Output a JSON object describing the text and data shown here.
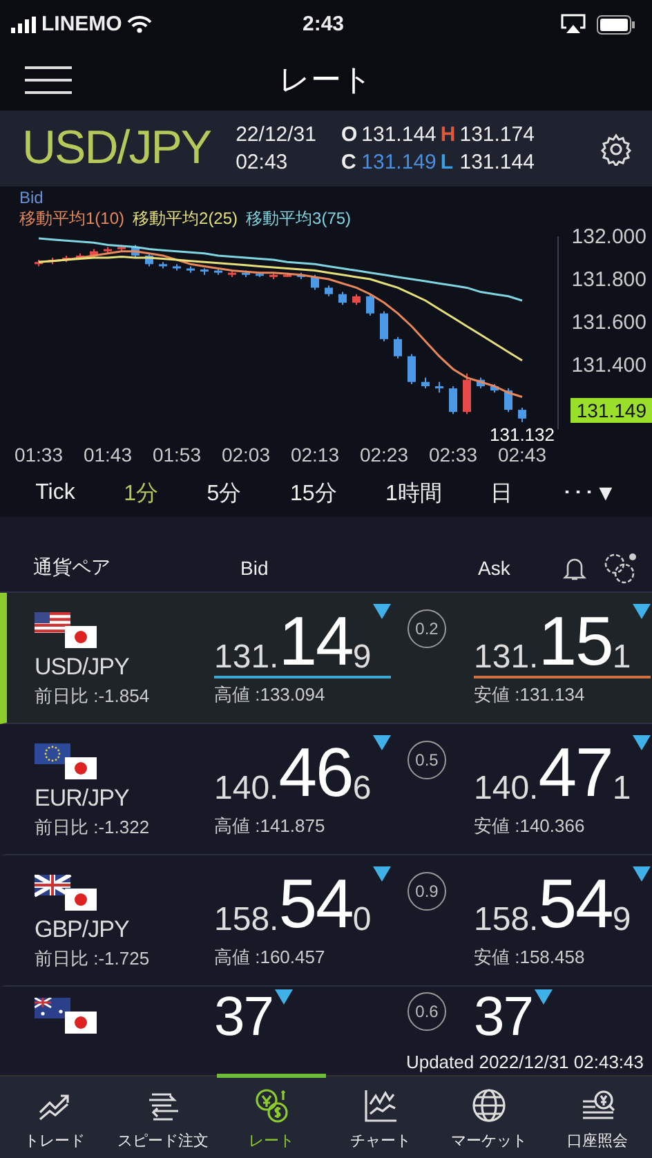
{
  "status_bar": {
    "carrier": "LINEMO",
    "time": "2:43"
  },
  "header": {
    "title": "レート"
  },
  "instrument": {
    "symbol": "USD/JPY",
    "date": "22/12/31",
    "time": "02:43",
    "open_label": "O",
    "open": "131.144",
    "high_label": "H",
    "high": "131.174",
    "close_label": "C",
    "close": "131.149",
    "low_label": "L",
    "low": "131.144"
  },
  "chart": {
    "price_type": "Bid",
    "low_marker": "131.132",
    "current_price": "131.149",
    "chart_data": {
      "type": "candlestick",
      "categories": [
        "01:33",
        null,
        null,
        null,
        null,
        "01:43",
        null,
        null,
        null,
        null,
        "01:53",
        null,
        null,
        null,
        null,
        "02:03",
        null,
        null,
        null,
        null,
        "02:13",
        null,
        null,
        null,
        null,
        "02:23",
        null,
        null,
        null,
        null,
        "02:33",
        null,
        null,
        null,
        null,
        "02:43"
      ],
      "ylim": [
        131.1,
        132.0
      ],
      "ohlc": [
        [
          131.87,
          131.89,
          131.86,
          131.88
        ],
        [
          131.88,
          131.9,
          131.87,
          131.89
        ],
        [
          131.89,
          131.91,
          131.88,
          131.9
        ],
        [
          131.9,
          131.92,
          131.89,
          131.91
        ],
        [
          131.91,
          131.94,
          131.9,
          131.93
        ],
        [
          131.93,
          131.95,
          131.92,
          131.94
        ],
        [
          131.94,
          131.96,
          131.93,
          131.95
        ],
        [
          131.95,
          131.96,
          131.9,
          131.91
        ],
        [
          131.91,
          131.92,
          131.86,
          131.87
        ],
        [
          131.87,
          131.88,
          131.85,
          131.86
        ],
        [
          131.86,
          131.87,
          131.84,
          131.85
        ],
        [
          131.85,
          131.86,
          131.83,
          131.84
        ],
        [
          131.845,
          131.85,
          131.82,
          131.84
        ],
        [
          131.84,
          131.85,
          131.82,
          131.83
        ],
        [
          131.82,
          131.84,
          131.81,
          131.83
        ],
        [
          131.83,
          131.84,
          131.81,
          131.82
        ],
        [
          131.825,
          131.83,
          131.81,
          131.82
        ],
        [
          131.81,
          131.83,
          131.8,
          131.82
        ],
        [
          131.815,
          131.83,
          131.81,
          131.82
        ],
        [
          131.82,
          131.83,
          131.8,
          131.81
        ],
        [
          131.81,
          131.82,
          131.75,
          131.76
        ],
        [
          131.76,
          131.77,
          131.72,
          131.73
        ],
        [
          131.73,
          131.74,
          131.68,
          131.69
        ],
        [
          131.69,
          131.73,
          131.68,
          131.72
        ],
        [
          131.72,
          131.73,
          131.63,
          131.64
        ],
        [
          131.64,
          131.65,
          131.51,
          131.52
        ],
        [
          131.52,
          131.53,
          131.43,
          131.44
        ],
        [
          131.44,
          131.45,
          131.31,
          131.32
        ],
        [
          131.32,
          131.34,
          131.29,
          131.3
        ],
        [
          131.3,
          131.32,
          131.27,
          131.29
        ],
        [
          131.29,
          131.3,
          131.17,
          131.18
        ],
        [
          131.18,
          131.36,
          131.17,
          131.33
        ],
        [
          131.33,
          131.34,
          131.29,
          131.3
        ],
        [
          131.3,
          131.31,
          131.27,
          131.28
        ],
        [
          131.28,
          131.29,
          131.18,
          131.19
        ],
        [
          131.19,
          131.2,
          131.132,
          131.149
        ]
      ],
      "series": [
        {
          "type": "line",
          "name": "移動平均1(10)",
          "color": "#e8875a",
          "values": [
            131.88,
            131.885,
            131.89,
            131.9,
            131.91,
            131.92,
            131.93,
            131.93,
            131.92,
            131.91,
            131.89,
            131.87,
            131.86,
            131.85,
            131.84,
            131.835,
            131.83,
            131.83,
            131.825,
            131.82,
            131.81,
            131.8,
            131.78,
            131.76,
            131.73,
            131.69,
            131.64,
            131.58,
            131.51,
            131.44,
            131.38,
            131.34,
            131.32,
            131.3,
            131.27,
            131.25
          ]
        },
        {
          "type": "line",
          "name": "移動平均2(25)",
          "color": "#e6e07a",
          "values": [
            131.88,
            131.885,
            131.89,
            131.895,
            131.9,
            131.9,
            131.905,
            131.9,
            131.9,
            131.895,
            131.89,
            131.885,
            131.88,
            131.875,
            131.87,
            131.865,
            131.86,
            131.855,
            131.85,
            131.845,
            131.84,
            131.83,
            131.82,
            131.81,
            131.8,
            131.78,
            131.76,
            131.73,
            131.7,
            131.66,
            131.62,
            131.58,
            131.54,
            131.5,
            131.46,
            131.42
          ]
        },
        {
          "type": "line",
          "name": "移動平均3(75)",
          "color": "#7fd6e0",
          "values": [
            131.99,
            131.985,
            131.98,
            131.975,
            131.97,
            131.96,
            131.955,
            131.95,
            131.94,
            131.935,
            131.93,
            131.925,
            131.92,
            131.91,
            131.905,
            131.9,
            131.895,
            131.89,
            131.88,
            131.875,
            131.87,
            131.86,
            131.85,
            131.84,
            131.83,
            131.82,
            131.81,
            131.8,
            131.79,
            131.78,
            131.77,
            131.76,
            131.74,
            131.73,
            131.72,
            131.7
          ]
        }
      ],
      "yticks": [
        {
          "value": 131.4,
          "label": "131.400"
        },
        {
          "value": 131.6,
          "label": "131.600"
        },
        {
          "value": 131.8,
          "label": "131.800"
        },
        {
          "value": 132.0,
          "label": "132.000"
        }
      ]
    }
  },
  "periods": [
    {
      "label": "Tick",
      "selected": false
    },
    {
      "label": "1分",
      "selected": true
    },
    {
      "label": "5分",
      "selected": false
    },
    {
      "label": "15分",
      "selected": false
    },
    {
      "label": "1時間",
      "selected": false
    },
    {
      "label": "日",
      "selected": false
    },
    {
      "label": "･･･▼",
      "selected": false
    }
  ],
  "columns": {
    "pair": "通貨ペア",
    "bid": "Bid",
    "ask": "Ask"
  },
  "rows": [
    {
      "kind": "us",
      "pair": "USD/JPY",
      "change": "前日比 :-1.854",
      "selected": true,
      "bid": {
        "head": "131.",
        "big": "14",
        "tail": "9",
        "falling": true
      },
      "high": "高値 :133.094",
      "spread": "0.2",
      "ask": {
        "head": "131.",
        "big": "15",
        "tail": "1",
        "falling": true
      },
      "low": "安値 :131.134"
    },
    {
      "kind": "eu",
      "pair": "EUR/JPY",
      "change": "前日比 :-1.322",
      "selected": false,
      "bid": {
        "head": "140.",
        "big": "46",
        "tail": "6",
        "falling": true
      },
      "high": "高値 :141.875",
      "spread": "0.5",
      "ask": {
        "head": "140.",
        "big": "47",
        "tail": "1",
        "falling": true
      },
      "low": "安値 :140.366"
    },
    {
      "kind": "gb",
      "pair": "GBP/JPY",
      "change": "前日比 :-1.725",
      "selected": false,
      "bid": {
        "head": "158.",
        "big": "54",
        "tail": "0",
        "falling": true
      },
      "high": "高値 :160.457",
      "spread": "0.9",
      "ask": {
        "head": "158.",
        "big": "54",
        "tail": "9",
        "falling": true
      },
      "low": "安値 :158.458"
    },
    {
      "kind": "au",
      "selected": false,
      "bid": {
        "big": "37",
        "falling": true
      },
      "spread": "0.6",
      "ask": {
        "big": "37",
        "falling": true
      }
    }
  ],
  "updated": "Updated  2022/12/31 02:43:43",
  "nav": [
    {
      "kind": "trade",
      "label": "トレード",
      "selected": false
    },
    {
      "kind": "speed",
      "label": "スピード注文",
      "selected": false
    },
    {
      "kind": "rate",
      "label": "レート",
      "selected": true
    },
    {
      "kind": "chart",
      "label": "チャート",
      "selected": false
    },
    {
      "kind": "market",
      "label": "マーケット",
      "selected": false
    },
    {
      "kind": "account",
      "label": "口座照会",
      "selected": false
    }
  ]
}
